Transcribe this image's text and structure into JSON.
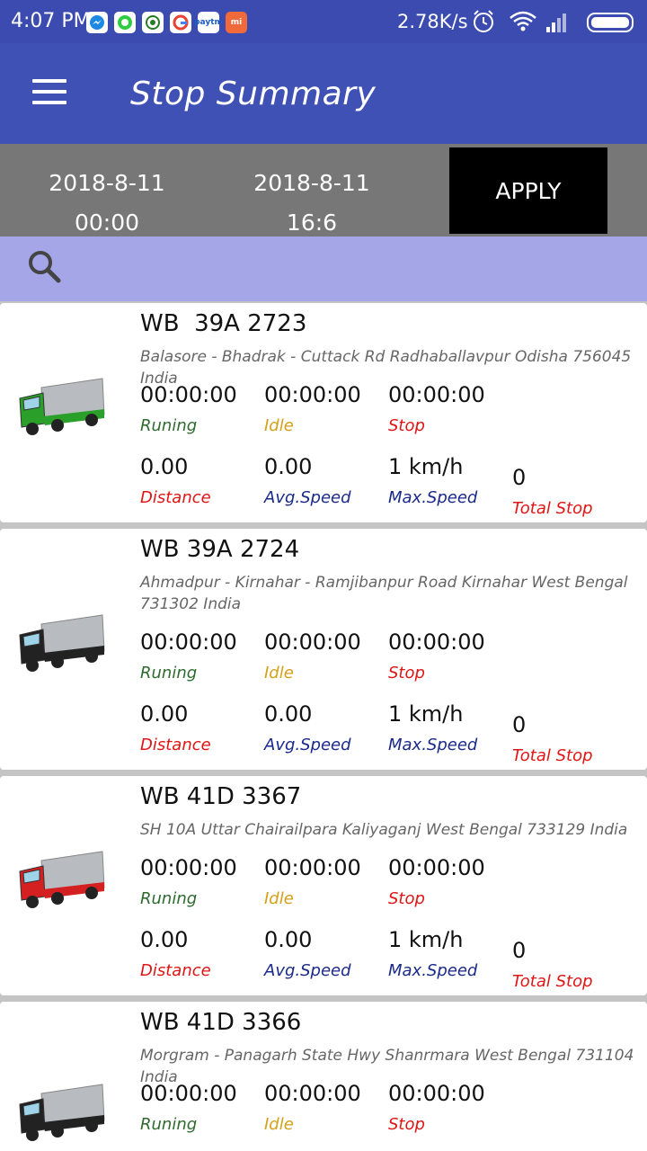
{
  "status_bar": {
    "time": "4:07 PM",
    "apps": [
      "messenger-icon",
      "whatsapp-icon",
      "app-icon",
      "google-icon",
      "paytm-icon",
      "mi-icon"
    ],
    "paytm_label": "paytm",
    "mi_label": "mi",
    "network_speed": "2.78K/s"
  },
  "app_bar": {
    "title": "Stop Summary"
  },
  "filter": {
    "from_date": "2018-8-11",
    "from_time": "00:00",
    "to_date": "2018-8-11",
    "to_time": "16:6",
    "apply_label": "APPLY"
  },
  "labels": {
    "running": "Runing",
    "idle": "Idle",
    "stop": "Stop",
    "distance": "Distance",
    "avg_speed": "Avg.Speed",
    "max_speed": "Max.Speed",
    "total_stop": "Total Stop"
  },
  "vehicles": [
    {
      "plate": "WB  39A 2723",
      "address": "Balasore - Bhadrak - Cuttack Rd Radhaballavpur Odisha 756045 India",
      "running": "00:00:00",
      "idle": "00:00:00",
      "stop": "00:00:00",
      "distance": "0.00",
      "avg_speed": "0.00",
      "max_speed": "1 km/h",
      "total_stop": "0",
      "truck_color": "#2aa02a"
    },
    {
      "plate": "WB 39A 2724",
      "address": "Ahmadpur - Kirnahar - Ramjibanpur Road Kirnahar West Bengal 731302 India",
      "running": "00:00:00",
      "idle": "00:00:00",
      "stop": "00:00:00",
      "distance": "0.00",
      "avg_speed": "0.00",
      "max_speed": "1 km/h",
      "total_stop": "0",
      "truck_color": "#222222"
    },
    {
      "plate": "WB 41D 3367",
      "address": "SH 10A Uttar Chairailpara Kaliyaganj West Bengal 733129 India",
      "running": "00:00:00",
      "idle": "00:00:00",
      "stop": "00:00:00",
      "distance": "0.00",
      "avg_speed": "0.00",
      "max_speed": "1 km/h",
      "total_stop": "0",
      "truck_color": "#d42020"
    },
    {
      "plate": "WB 41D 3366",
      "address": "Morgram - Panagarh State Hwy Shanrmara West Bengal 731104 India",
      "running": "00:00:00",
      "idle": "00:00:00",
      "stop": "00:00:00",
      "truck_color": "#222222"
    }
  ]
}
